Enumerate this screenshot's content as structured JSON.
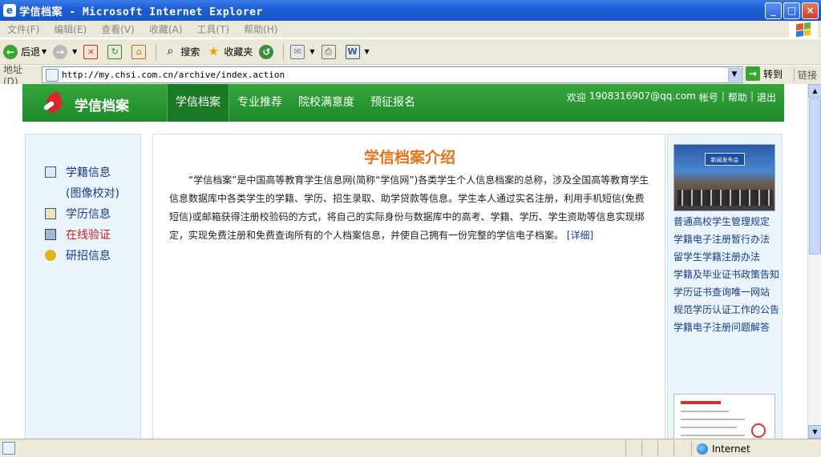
{
  "window": {
    "title": "学信档案 - Microsoft Internet Explorer",
    "buttons": {
      "minimize": "_",
      "maximize": "□",
      "close": "×"
    }
  },
  "menu": [
    "文件(F)",
    "编辑(E)",
    "查看(V)",
    "收藏(A)",
    "工具(T)",
    "帮助(H)"
  ],
  "toolbar": {
    "back": "后退",
    "search": "搜索",
    "favorites": "收藏夹"
  },
  "address": {
    "label": "地址(D)",
    "url": "http://my.chsi.com.cn/archive/index.action",
    "go": "转到",
    "links": "链接"
  },
  "site": {
    "title": "学信档案",
    "nav": [
      "学信档案",
      "专业推荐",
      "院校满意度",
      "预征报名"
    ],
    "user": {
      "welcome": "欢迎",
      "email": "1908316907@qq.com",
      "account": "帐号",
      "help": "帮助",
      "logout": "退出",
      "sep": "|"
    }
  },
  "sidebar": {
    "items": [
      {
        "label": "学籍信息",
        "icon": "id-card-icon"
      },
      {
        "label": "(图像校对)",
        "icon": ""
      },
      {
        "label": "学历信息",
        "icon": "diploma-icon"
      },
      {
        "label": "在线验证",
        "icon": "verify-icon",
        "highlight": true
      },
      {
        "label": "研招信息",
        "icon": "medal-icon"
      }
    ]
  },
  "main": {
    "title": "学信档案介绍",
    "intro": "“学信档案”是中国高等教育学生信息网(简称“学信网”)各类学生个人信息档案的总称，涉及全国高等教育学生信息数据库中各类学生的学籍、学历、招生录取、助学贷款等信息。学生本人通过实名注册，利用手机短信(免费短信)或邮箱获得注册校验码的方式，将自己的实际身份与数据库中的高考、学籍、学历、学生资助等信息实现绑定，实现免费注册和免费查询所有的个人档案信息，并使自己拥有一份完整的学信电子档案。",
    "more": "[详细]"
  },
  "right": {
    "photo_banner": "新闻发布会",
    "links": [
      "普通高校学生管理规定",
      "学籍电子注册暂行办法",
      "留学生学籍注册办法",
      "学籍及毕业证书政策告知",
      "学历证书查询唯一网站",
      "规范学历认证工作的公告",
      "学籍电子注册问题解答"
    ]
  },
  "status": {
    "zone": "Internet"
  }
}
